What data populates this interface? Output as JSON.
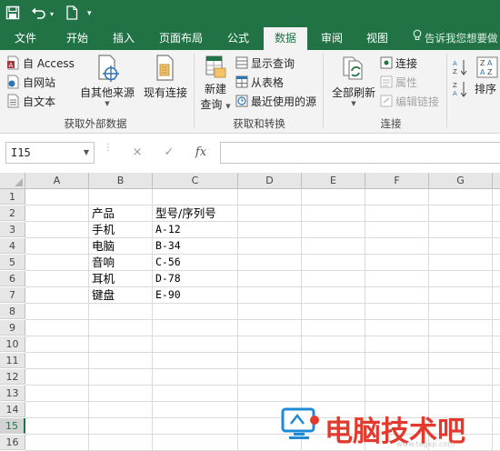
{
  "quick_access": {
    "save_icon": "save-icon",
    "undo_icon": "undo-icon",
    "new_icon": "new-document-icon",
    "customize_icon": "customize-toolbar-icon"
  },
  "ribbon_tabs": [
    {
      "label": "文件"
    },
    {
      "label": "开始"
    },
    {
      "label": "插入"
    },
    {
      "label": "页面布局"
    },
    {
      "label": "公式"
    },
    {
      "label": "数据",
      "active": true
    },
    {
      "label": "审阅"
    },
    {
      "label": "视图"
    }
  ],
  "tell_me": "告诉我您想要做",
  "ribbon": {
    "get_external": {
      "access": "自 Access",
      "web": "自网站",
      "text": "自文本",
      "other_sources": "自其他来源",
      "existing_connections": "现有连接",
      "label": "获取外部数据"
    },
    "get_transform": {
      "new_query_line1": "新建",
      "new_query_line2": "查询",
      "show_queries": "显示查询",
      "from_table": "从表格",
      "recent_sources": "最近使用的源",
      "label": "获取和转换"
    },
    "connections": {
      "refresh_all": "全部刷新",
      "connections": "连接",
      "properties": "属性",
      "edit_links": "编辑链接",
      "label": "连接"
    },
    "sort_filter": {
      "sort": "排序"
    }
  },
  "formula_bar": {
    "name_box": "I15",
    "cancel_icon": "×",
    "enter_icon": "✓",
    "fx_label": "fx",
    "formula": ""
  },
  "sheet": {
    "columns": [
      "A",
      "B",
      "C",
      "D",
      "E",
      "F",
      "G"
    ],
    "rows": [
      "1",
      "2",
      "3",
      "4",
      "5",
      "6",
      "7",
      "8",
      "9",
      "10",
      "11",
      "12",
      "13",
      "14",
      "15",
      "16"
    ],
    "selected_row": "15",
    "header": {
      "product": "产品",
      "model": "型号/序列号"
    },
    "data": [
      {
        "product": "手机",
        "model": "A-12"
      },
      {
        "product": "电脑",
        "model": "B-34"
      },
      {
        "product": "音响",
        "model": "C-56"
      },
      {
        "product": "耳机",
        "model": "D-78"
      },
      {
        "product": "键盘",
        "model": "E-90"
      }
    ]
  },
  "watermark": {
    "text": "电脑技术吧",
    "url": "www.tagxp.com"
  },
  "colors": {
    "excel_green": "#217346",
    "watermark_red": "#e23a2e"
  }
}
